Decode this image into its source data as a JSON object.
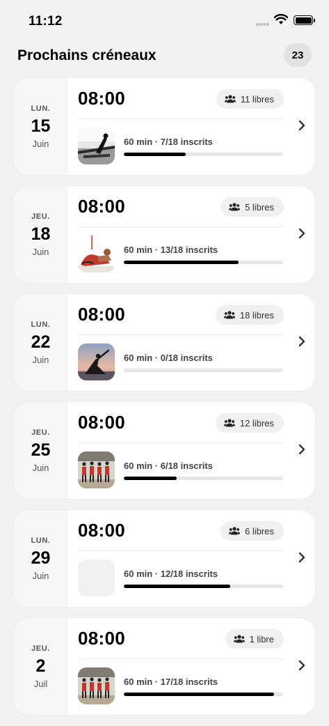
{
  "status_bar": {
    "time": "11:12"
  },
  "header": {
    "title": "Prochains créneaux",
    "count": "23"
  },
  "colors": {
    "accent": "#000000",
    "card_bg": "#f7f7f7",
    "panel_bg": "#ffffff",
    "track": "#e6e6e6"
  },
  "slots": [
    {
      "dow": "LUN.",
      "day": "15",
      "month": "Juin",
      "time": "08:00",
      "free": "11 libres",
      "info": "60 min · 7/18 inscrits",
      "enrolled": 7,
      "capacity": 18,
      "thumb": "photo-rowing-machine"
    },
    {
      "dow": "JEU.",
      "day": "18",
      "month": "Juin",
      "time": "08:00",
      "free": "5 libres",
      "info": "60 min · 13/18 inscrits",
      "enrolled": 13,
      "capacity": 18,
      "thumb": "photo-stretching"
    },
    {
      "dow": "LUN.",
      "day": "22",
      "month": "Juin",
      "time": "08:00",
      "free": "18 libres",
      "info": "60 min · 0/18 inscrits",
      "enrolled": 0,
      "capacity": 18,
      "thumb": "photo-yoga-sunset"
    },
    {
      "dow": "JEU.",
      "day": "25",
      "month": "Juin",
      "time": "08:00",
      "free": "12 libres",
      "info": "60 min · 6/18 inscrits",
      "enrolled": 6,
      "capacity": 18,
      "thumb": "photo-group-class"
    },
    {
      "dow": "LUN.",
      "day": "29",
      "month": "Juin",
      "time": "08:00",
      "free": "6 libres",
      "info": "60 min · 12/18 inscrits",
      "enrolled": 12,
      "capacity": 18,
      "thumb": "placeholder"
    },
    {
      "dow": "JEU.",
      "day": "2",
      "month": "Juil",
      "time": "08:00",
      "free": "1 libre",
      "info": "60 min · 17/18 inscrits",
      "enrolled": 17,
      "capacity": 18,
      "thumb": "photo-group-class"
    }
  ]
}
